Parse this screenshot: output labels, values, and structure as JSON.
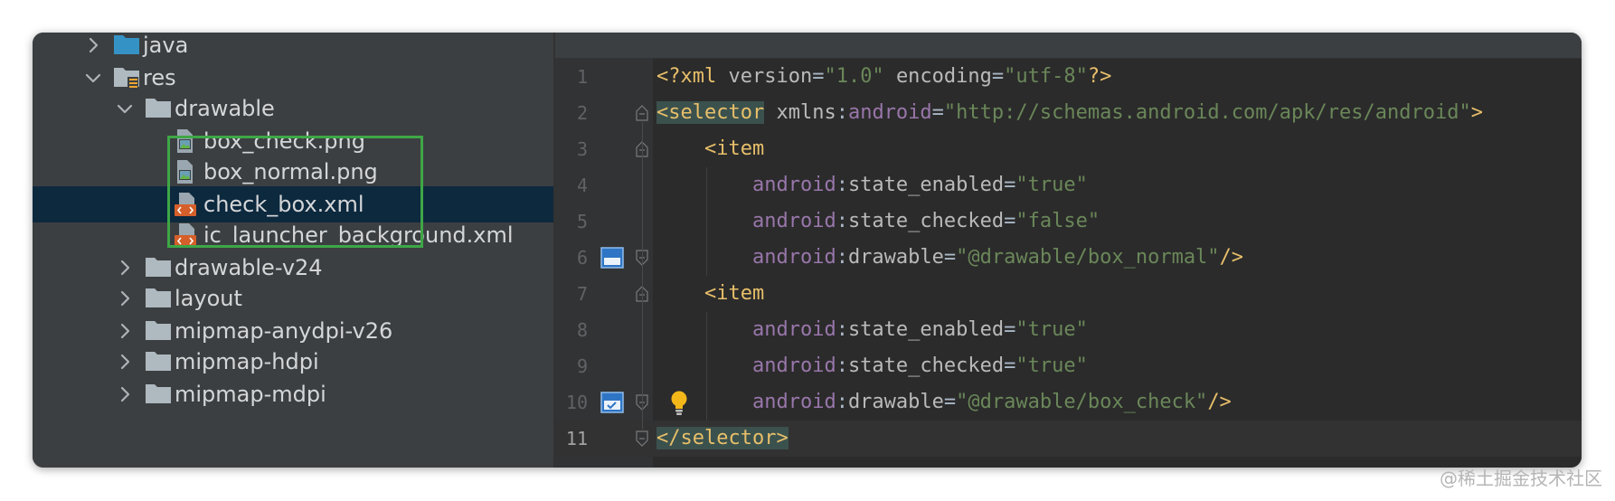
{
  "tree": {
    "items": [
      {
        "label": "java",
        "icon": "source-folder-icon",
        "expanded": false
      },
      {
        "label": "res",
        "icon": "resources-folder-icon",
        "expanded": true
      },
      {
        "label": "drawable",
        "icon": "folder-icon",
        "expanded": true
      },
      {
        "label": "box_check.png",
        "icon": "image-file-icon"
      },
      {
        "label": "box_normal.png",
        "icon": "image-file-icon"
      },
      {
        "label": "check_box.xml",
        "icon": "xml-file-icon",
        "selected": true
      },
      {
        "label": "ic_launcher_background.xml",
        "icon": "xml-file-icon"
      },
      {
        "label": "drawable-v24",
        "icon": "folder-icon",
        "expanded": false
      },
      {
        "label": "layout",
        "icon": "folder-icon",
        "expanded": false
      },
      {
        "label": "mipmap-anydpi-v26",
        "icon": "folder-icon",
        "expanded": false
      },
      {
        "label": "mipmap-hdpi",
        "icon": "folder-icon",
        "expanded": false
      },
      {
        "label": "mipmap-mdpi",
        "icon": "folder-icon",
        "expanded": false
      }
    ]
  },
  "editor": {
    "lines": [
      {
        "num": "1",
        "tokens": [
          [
            "tag",
            "<?xml "
          ],
          [
            "attr",
            "version"
          ],
          [
            "plain",
            "="
          ],
          [
            "str",
            "\"1.0\""
          ],
          [
            "plain",
            " "
          ],
          [
            "attr",
            "encoding"
          ],
          [
            "plain",
            "="
          ],
          [
            "str",
            "\"utf-8\""
          ],
          [
            "tag",
            "?>"
          ]
        ]
      },
      {
        "num": "2",
        "tokens": [
          [
            "taghl",
            "<selector"
          ],
          [
            "plain",
            " "
          ],
          [
            "attr",
            "xmlns"
          ],
          [
            "plain",
            ":"
          ],
          [
            "ns",
            "android"
          ],
          [
            "plain",
            "="
          ],
          [
            "str",
            "\"http://schemas.android.com/apk/res/android\""
          ],
          [
            "tag",
            ">"
          ]
        ]
      },
      {
        "num": "3",
        "tokens": [
          [
            "plain",
            "    "
          ],
          [
            "tag",
            "<item"
          ]
        ]
      },
      {
        "num": "4",
        "tokens": [
          [
            "plain",
            "        "
          ],
          [
            "ns",
            "android"
          ],
          [
            "plain",
            ":"
          ],
          [
            "attr",
            "state_enabled"
          ],
          [
            "plain",
            "="
          ],
          [
            "str",
            "\"true\""
          ]
        ]
      },
      {
        "num": "5",
        "tokens": [
          [
            "plain",
            "        "
          ],
          [
            "ns",
            "android"
          ],
          [
            "plain",
            ":"
          ],
          [
            "attr",
            "state_checked"
          ],
          [
            "plain",
            "="
          ],
          [
            "str",
            "\"false\""
          ]
        ]
      },
      {
        "num": "6",
        "tokens": [
          [
            "plain",
            "        "
          ],
          [
            "ns",
            "android"
          ],
          [
            "plain",
            ":"
          ],
          [
            "attr",
            "drawable"
          ],
          [
            "plain",
            "="
          ],
          [
            "str",
            "\"@drawable/box_normal\""
          ],
          [
            "tag",
            "/>"
          ]
        ]
      },
      {
        "num": "7",
        "tokens": [
          [
            "plain",
            "    "
          ],
          [
            "tag",
            "<item"
          ]
        ]
      },
      {
        "num": "8",
        "tokens": [
          [
            "plain",
            "        "
          ],
          [
            "ns",
            "android"
          ],
          [
            "plain",
            ":"
          ],
          [
            "attr",
            "state_enabled"
          ],
          [
            "plain",
            "="
          ],
          [
            "str",
            "\"true\""
          ]
        ]
      },
      {
        "num": "9",
        "tokens": [
          [
            "plain",
            "        "
          ],
          [
            "ns",
            "android"
          ],
          [
            "plain",
            ":"
          ],
          [
            "attr",
            "state_checked"
          ],
          [
            "plain",
            "="
          ],
          [
            "str",
            "\"true\""
          ]
        ]
      },
      {
        "num": "10",
        "tokens": [
          [
            "plain",
            "        "
          ],
          [
            "ns",
            "android"
          ],
          [
            "plain",
            ":"
          ],
          [
            "attr",
            "drawable"
          ],
          [
            "plain",
            "="
          ],
          [
            "str",
            "\"@drawable/box_check\""
          ],
          [
            "tag",
            "/>"
          ]
        ]
      },
      {
        "num": "11",
        "tokens": [
          [
            "taghl",
            "</selector"
          ],
          [
            "taghl",
            ">"
          ]
        ]
      }
    ],
    "current_line": "11"
  },
  "watermark": "@稀土掘金技术社区",
  "colors": {
    "tree_bg": "#3c3f41",
    "selection": "#0d293e",
    "highlight_box": "#3ea747",
    "editor_bg": "#2b2b2b",
    "tag": "#e8bf6a",
    "namespace": "#9876aa",
    "string": "#6a8759"
  }
}
